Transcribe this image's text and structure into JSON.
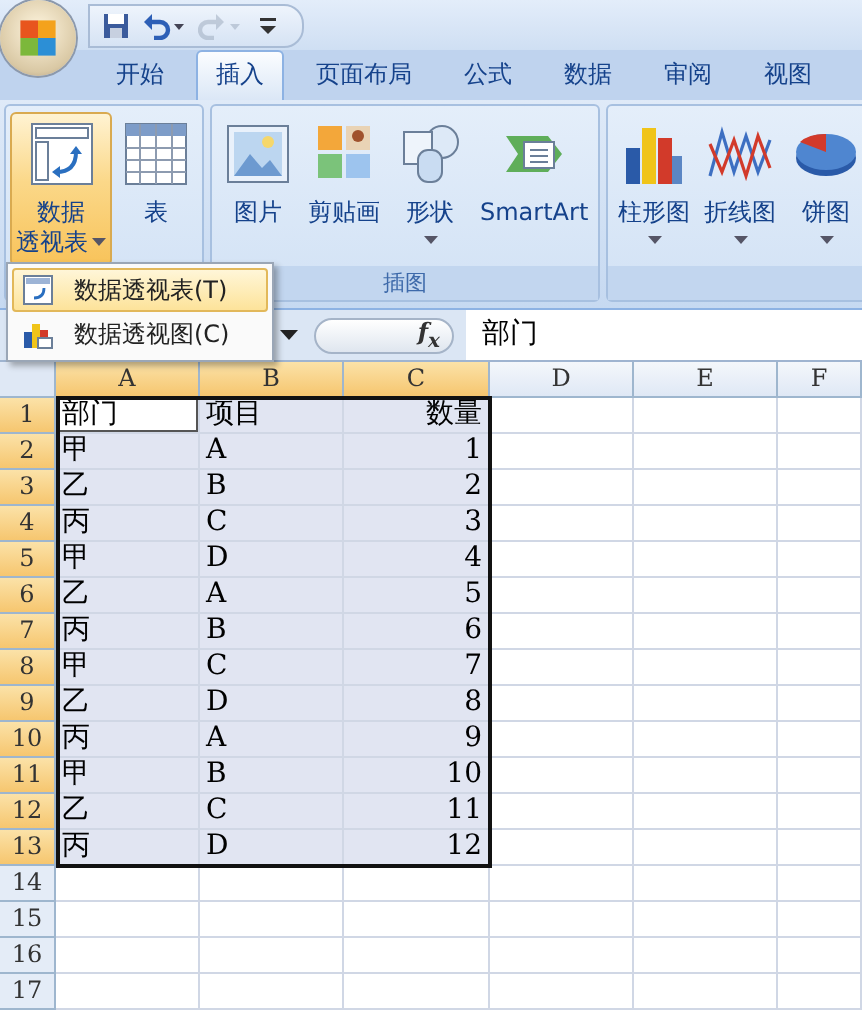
{
  "quick_access": [
    {
      "kind": "save",
      "disabled": false,
      "dropdown": false
    },
    {
      "kind": "undo",
      "disabled": false,
      "dropdown": true
    },
    {
      "kind": "redo",
      "disabled": true,
      "dropdown": true
    },
    {
      "kind": "customize",
      "disabled": false,
      "dropdown": false
    }
  ],
  "tabs": [
    {
      "label": "开始",
      "selected": false
    },
    {
      "label": "插入",
      "selected": true
    },
    {
      "label": "页面布局",
      "selected": false
    },
    {
      "label": "公式",
      "selected": false
    },
    {
      "label": "数据",
      "selected": false
    },
    {
      "label": "审阅",
      "selected": false
    },
    {
      "label": "视图",
      "selected": false
    }
  ],
  "ribbon_groups": [
    {
      "buttons": [
        {
          "kind": "pivot",
          "lines": [
            "数据",
            "透视表"
          ],
          "dropdown": true,
          "pressed": true
        },
        {
          "kind": "table",
          "lines": [
            "表"
          ],
          "dropdown": false,
          "pressed": false
        }
      ]
    },
    {
      "label": "插图",
      "buttons": [
        {
          "kind": "picture",
          "lines": [
            "图片"
          ],
          "dropdown": false,
          "pressed": false
        },
        {
          "kind": "clipart",
          "lines": [
            "剪贴画"
          ],
          "dropdown": false,
          "pressed": false
        },
        {
          "kind": "shapes",
          "lines": [
            "形状"
          ],
          "dropdown": true,
          "pressed": false
        },
        {
          "kind": "smartart",
          "lines": [
            "SmartArt"
          ],
          "dropdown": false,
          "pressed": false
        }
      ]
    },
    {
      "buttons": [
        {
          "kind": "column",
          "lines": [
            "柱形图"
          ],
          "dropdown": true,
          "pressed": false
        },
        {
          "kind": "line",
          "lines": [
            "折线图"
          ],
          "dropdown": true,
          "pressed": false
        },
        {
          "kind": "pie",
          "lines": [
            "饼图"
          ],
          "dropdown": true,
          "pressed": false
        }
      ]
    }
  ],
  "menu": [
    {
      "kind": "pivot-table",
      "label": "数据透视表(T)",
      "selected": true
    },
    {
      "kind": "pivot-chart",
      "label": "数据透视图(C)",
      "selected": false
    }
  ],
  "formula_bar": {
    "fx": "f$_{x}$",
    "value": "部门"
  },
  "sheet": {
    "columns": [
      {
        "label": "A",
        "kind": "text",
        "selected": true
      },
      {
        "label": "B",
        "kind": "text",
        "selected": true
      },
      {
        "label": "C",
        "kind": "number",
        "selected": true
      },
      {
        "label": "D",
        "selected": false
      },
      {
        "label": "E",
        "selected": false
      },
      {
        "label": "F",
        "selected": false
      }
    ],
    "rows": [
      {
        "number": "1",
        "selected": true,
        "cells": [
          {
            "text": "部门",
            "active": true
          },
          {
            "text": "项目",
            "active": false
          },
          {
            "text": "数量",
            "active": false
          }
        ]
      },
      {
        "number": "2",
        "selected": true,
        "cells": [
          {
            "text": "甲",
            "active": false
          },
          {
            "text": "A",
            "active": false
          },
          {
            "text": "1",
            "active": false
          }
        ]
      },
      {
        "number": "3",
        "selected": true,
        "cells": [
          {
            "text": "乙",
            "active": false
          },
          {
            "text": "B",
            "active": false
          },
          {
            "text": "2",
            "active": false
          }
        ]
      },
      {
        "number": "4",
        "selected": true,
        "cells": [
          {
            "text": "丙",
            "active": false
          },
          {
            "text": "C",
            "active": false
          },
          {
            "text": "3",
            "active": false
          }
        ]
      },
      {
        "number": "5",
        "selected": true,
        "cells": [
          {
            "text": "甲",
            "active": false
          },
          {
            "text": "D",
            "active": false
          },
          {
            "text": "4",
            "active": false
          }
        ]
      },
      {
        "number": "6",
        "selected": true,
        "cells": [
          {
            "text": "乙",
            "active": false
          },
          {
            "text": "A",
            "active": false
          },
          {
            "text": "5",
            "active": false
          }
        ]
      },
      {
        "number": "7",
        "selected": true,
        "cells": [
          {
            "text": "丙",
            "active": false
          },
          {
            "text": "B",
            "active": false
          },
          {
            "text": "6",
            "active": false
          }
        ]
      },
      {
        "number": "8",
        "selected": true,
        "cells": [
          {
            "text": "甲",
            "active": false
          },
          {
            "text": "C",
            "active": false
          },
          {
            "text": "7",
            "active": false
          }
        ]
      },
      {
        "number": "9",
        "selected": true,
        "cells": [
          {
            "text": "乙",
            "active": false
          },
          {
            "text": "D",
            "active": false
          },
          {
            "text": "8",
            "active": false
          }
        ]
      },
      {
        "number": "10",
        "selected": true,
        "cells": [
          {
            "text": "丙",
            "active": false
          },
          {
            "text": "A",
            "active": false
          },
          {
            "text": "9",
            "active": false
          }
        ]
      },
      {
        "number": "11",
        "selected": true,
        "cells": [
          {
            "text": "甲",
            "active": false
          },
          {
            "text": "B",
            "active": false
          },
          {
            "text": "10",
            "active": false
          }
        ]
      },
      {
        "number": "12",
        "selected": true,
        "cells": [
          {
            "text": "乙",
            "active": false
          },
          {
            "text": "C",
            "active": false
          },
          {
            "text": "11",
            "active": false
          }
        ]
      },
      {
        "number": "13",
        "selected": true,
        "cells": [
          {
            "text": "丙",
            "active": false
          },
          {
            "text": "D",
            "active": false
          },
          {
            "text": "12",
            "active": false
          }
        ]
      },
      {
        "number": "14",
        "selected": false,
        "cells": []
      },
      {
        "number": "15",
        "selected": false,
        "cells": []
      },
      {
        "number": "16",
        "selected": false,
        "cells": []
      },
      {
        "number": "17",
        "selected": false,
        "cells": []
      }
    ]
  }
}
